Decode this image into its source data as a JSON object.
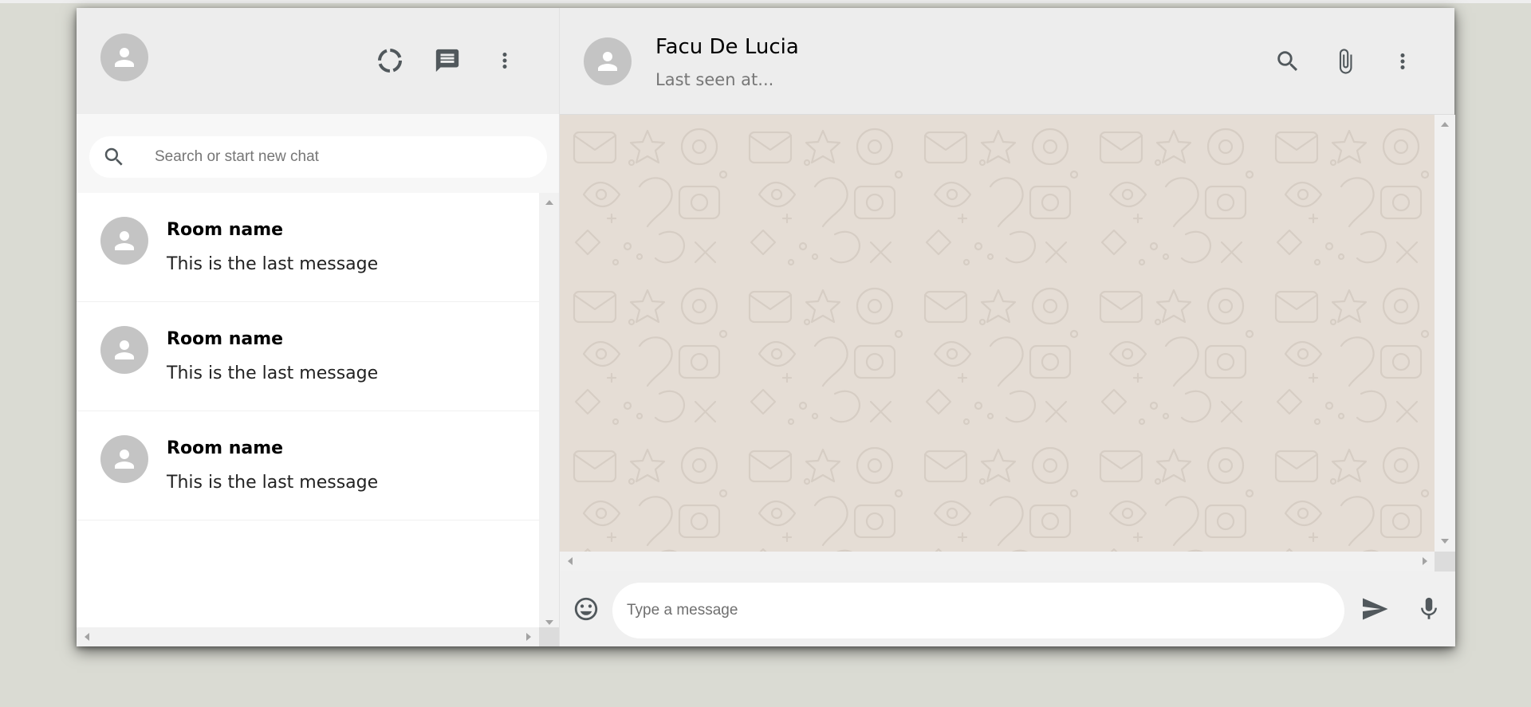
{
  "sidebar": {
    "header": {
      "avatar_icon": "person-icon",
      "status_icon": "status-icon",
      "new_chat_icon": "chat-icon",
      "menu_icon": "more-vert-icon"
    },
    "search": {
      "placeholder": "Search or start new chat",
      "icon": "search-icon"
    },
    "chats": [
      {
        "name": "Room name",
        "last_message": "This is the last message"
      },
      {
        "name": "Room name",
        "last_message": "This is the last message"
      },
      {
        "name": "Room name",
        "last_message": "This is the last message"
      }
    ]
  },
  "chat": {
    "header": {
      "contact_name": "Facu De Lucia",
      "last_seen": "Last seen at...",
      "search_icon": "search-icon",
      "attach_icon": "attach-icon",
      "menu_icon": "more-vert-icon"
    },
    "footer": {
      "emoji_icon": "emoji-icon",
      "placeholder": "Type a message",
      "send_icon": "send-icon",
      "mic_icon": "mic-icon"
    }
  },
  "colors": {
    "page_background": "#dadbd3",
    "header_background": "#ededed",
    "chat_background": "#e5ddd5",
    "icon_color": "#51585c",
    "avatar_gray": "#c4c4c4"
  }
}
